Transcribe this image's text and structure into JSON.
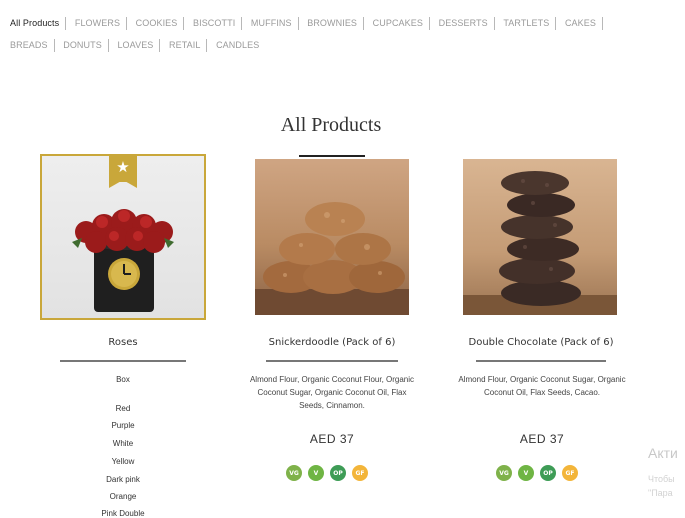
{
  "categories_row1": [
    "All Products",
    "FLOWERS",
    "COOKIES",
    "BISCOTTI",
    "MUFFINS",
    "BROWNIES",
    "CUPCAKES",
    "DESSERTS",
    "TARTLETS",
    "CAKES"
  ],
  "categories_row2": [
    "BREADS",
    "DONUTS",
    "LOAVES",
    "RETAIL",
    "CANDLES"
  ],
  "page_title": "All Products",
  "products": [
    {
      "name": "Roses",
      "description": "",
      "price": "",
      "badge": "★"
    },
    {
      "name": "Snickerdoodle (Pack of 6)",
      "description": "Almond Flour, Organic Coconut Flour, Organic Coconut Sugar, Organic Coconut Oil, Flax Seeds, Cinnamon.",
      "price": "AED 37",
      "badges": [
        "VG",
        "V",
        "OP",
        "GF"
      ]
    },
    {
      "name": "Double Chocolate (Pack of 6)",
      "description": "Almond Flour, Organic Coconut Sugar, Organic Coconut Oil, Flax Seeds, Cacao.",
      "price": "AED 37",
      "badges": [
        "VG",
        "V",
        "OP",
        "GF"
      ]
    }
  ],
  "roses_options": {
    "heading": "Box",
    "colors": [
      "Red",
      "Purple",
      "White",
      "Yellow",
      "Dark pink",
      "Orange",
      "Pink Double"
    ]
  },
  "watermark": {
    "line1": "Акти",
    "line2": "Чтобы",
    "line3": "\"Пара"
  }
}
